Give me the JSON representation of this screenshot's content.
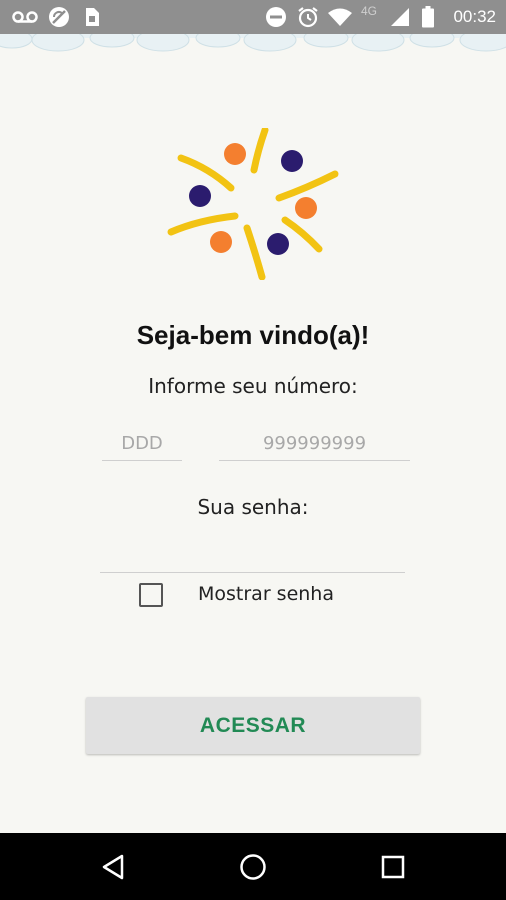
{
  "status_bar": {
    "time": "00:32",
    "network": "4G",
    "icons": [
      "voicemail-icon",
      "sync-off-icon",
      "sim-icon",
      "do-not-disturb-icon",
      "alarm-icon",
      "wifi-icon",
      "signal-icon",
      "battery-icon"
    ]
  },
  "login": {
    "welcome": "Seja-bem vindo(a)!",
    "phone_label": "Informe seu número:",
    "ddd_placeholder": "DDD",
    "phone_placeholder": "999999999",
    "password_label": "Sua senha:",
    "password_value": "",
    "show_password_label": "Mostrar senha",
    "show_password_checked": false,
    "submit_label": "ACESSAR"
  },
  "colors": {
    "accent_green": "#228a55",
    "logo_orange": "#f47f2f",
    "logo_navy": "#2b1c6e",
    "logo_yellow": "#f2c313"
  },
  "nav_bar": {
    "icons": [
      "back-icon",
      "home-icon",
      "recents-icon"
    ]
  }
}
